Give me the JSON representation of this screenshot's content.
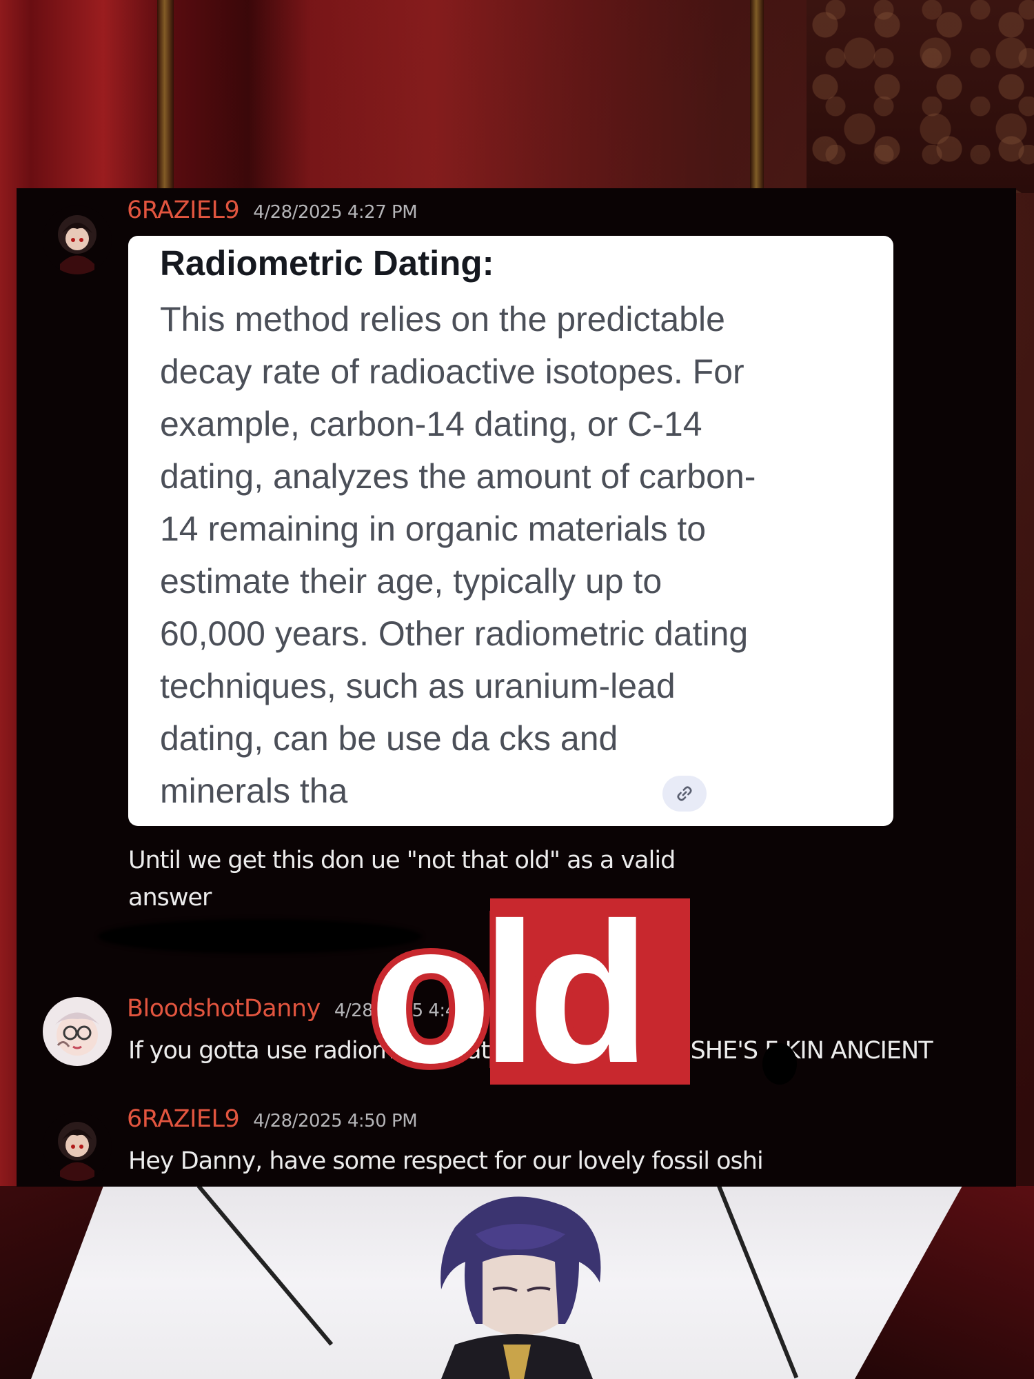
{
  "messages": [
    {
      "username": "6RAZIEL9",
      "timestamp": "4/28/2025 4:27 PM",
      "embed": {
        "title": "Radiometric Dating:",
        "lines": [
          "This method relies on the predictable",
          "decay rate of radioactive isotopes. For",
          "example, carbon-14 dating, or C-14",
          "dating, analyzes the amount of carbon-",
          "14 remaining in organic materials to",
          "estimate their age, typically up to",
          "60,000 years. Other radiometric dating",
          "techniques, such as uranium-lead",
          "dating, can be use      da      cks and",
          "minerals tha"
        ],
        "link_icon": "link-icon"
      },
      "text_lines": [
        "Until we get this don                                     ue \"not that old\" as a valid",
        "answer"
      ]
    },
    {
      "username": "BloodshotDanny",
      "timestamp": "4/28/2025 4:49 PM",
      "text": "If you gotta use radiometric dating she's not old, SHE'S F     KIN ANCIENT"
    },
    {
      "username": "6RAZIEL9",
      "timestamp": "4/28/2025 4:50 PM",
      "text": "Hey Danny, have some respect for our lovely fossil oshi"
    }
  ],
  "overlay": {
    "word": "old"
  },
  "colors": {
    "username": "#e2553f",
    "timestamp": "#b5b5b8",
    "panel": "#0a0304",
    "overlay_red": "#c8282e"
  }
}
